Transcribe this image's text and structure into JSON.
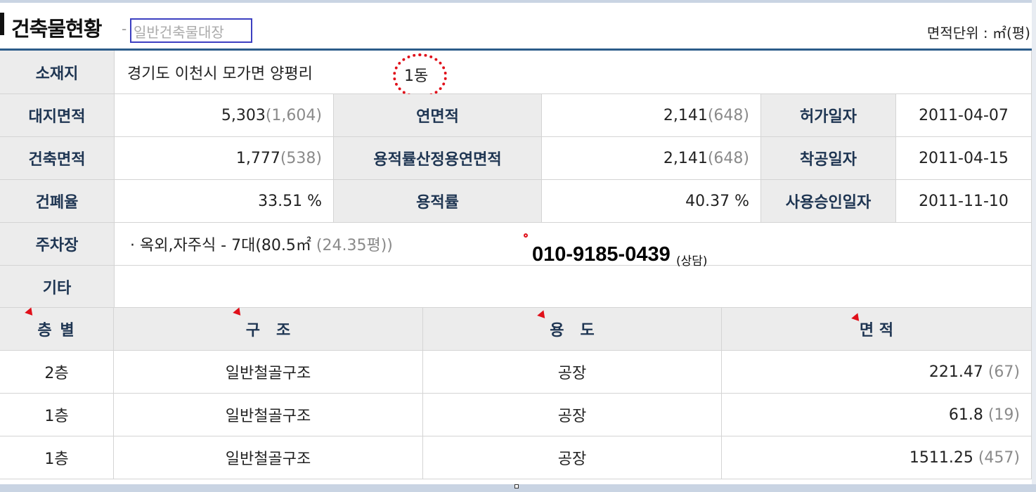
{
  "header": {
    "title": "건축물현황",
    "dash": "-",
    "subtitle": "일반건축물대장",
    "unit_label": "면적단위 : ㎡",
    "unit_paren": "(평)"
  },
  "summary": {
    "location_label": "소재지",
    "location_value": "경기도 이천시 모가면 양평리",
    "building_no": "1동",
    "site_area_label": "대지면적",
    "site_area_value": "5,303",
    "site_area_pyeong": "(1,604)",
    "total_floor_label": "연면적",
    "total_floor_value": "2,141",
    "total_floor_pyeong": "(648)",
    "permit_date_label": "허가일자",
    "permit_date_value": "2011-04-07",
    "building_area_label": "건축면적",
    "building_area_value": "1,777",
    "building_area_pyeong": "(538)",
    "far_floor_label": "용적률산정용연면적",
    "far_floor_value": "2,141",
    "far_floor_pyeong": "(648)",
    "start_date_label": "착공일자",
    "start_date_value": "2011-04-15",
    "bcr_label": "건폐율",
    "bcr_value": "33.51 %",
    "far_label": "용적률",
    "far_value": "40.37 %",
    "approval_date_label": "사용승인일자",
    "approval_date_value": "2011-11-10",
    "parking_label": "주차장",
    "parking_value": "· 옥외,자주식 - 7대(80.5㎡",
    "parking_pyeong": "(24.35평))",
    "other_label": "기타",
    "other_value": ""
  },
  "overlay": {
    "phone": "010-9185-0439",
    "phone_note": "(상담)"
  },
  "floors": {
    "headers": [
      "층 별",
      "구   조",
      "용   도",
      "면 적"
    ],
    "rows": [
      {
        "floor": "2층",
        "structure": "일반철골구조",
        "use": "공장",
        "area": "221.47",
        "pyeong": "(67)"
      },
      {
        "floor": "1층",
        "structure": "일반철골구조",
        "use": "공장",
        "area": "61.8",
        "pyeong": "(19)"
      },
      {
        "floor": "1층",
        "structure": "일반철골구조",
        "use": "공장",
        "area": "1511.25",
        "pyeong": "(457)"
      }
    ]
  },
  "colors": {
    "accent_blue": "#2c5c8a",
    "header_text": "#1e3552",
    "annotation_red": "#e0101a",
    "subtitle_box": "#3c3fc1"
  }
}
